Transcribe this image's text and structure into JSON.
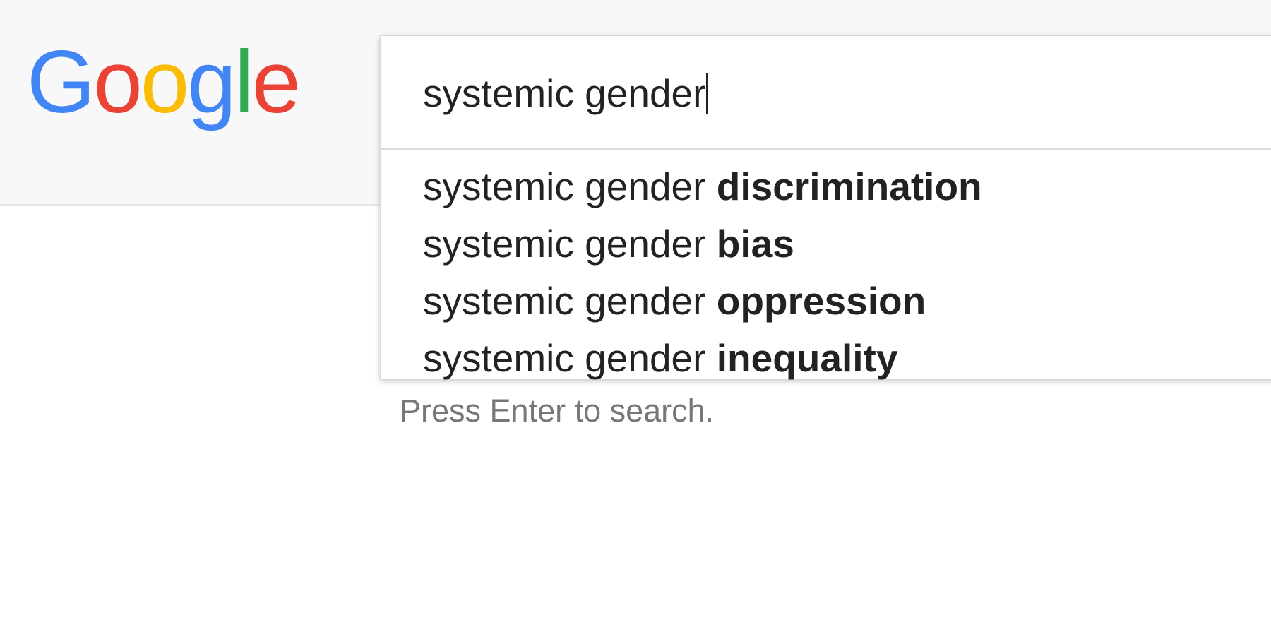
{
  "logo": {
    "letters": [
      {
        "char": "G",
        "color": "#4285F4"
      },
      {
        "char": "o",
        "color": "#EA4335"
      },
      {
        "char": "o",
        "color": "#FBBC05"
      },
      {
        "char": "g",
        "color": "#4285F4"
      },
      {
        "char": "l",
        "color": "#34A853"
      },
      {
        "char": "e",
        "color": "#EA4335"
      }
    ]
  },
  "search": {
    "query": "systemic gender"
  },
  "suggestions": [
    {
      "prefix": "systemic gender ",
      "completion": "discrimination"
    },
    {
      "prefix": "systemic gender ",
      "completion": "bias"
    },
    {
      "prefix": "systemic gender ",
      "completion": "oppression"
    },
    {
      "prefix": "systemic gender ",
      "completion": "inequality"
    }
  ],
  "hint": "Press Enter to search.",
  "colors": {
    "header_bg": "#f8f8f8",
    "text": "#222222",
    "hint_text": "#777777"
  }
}
